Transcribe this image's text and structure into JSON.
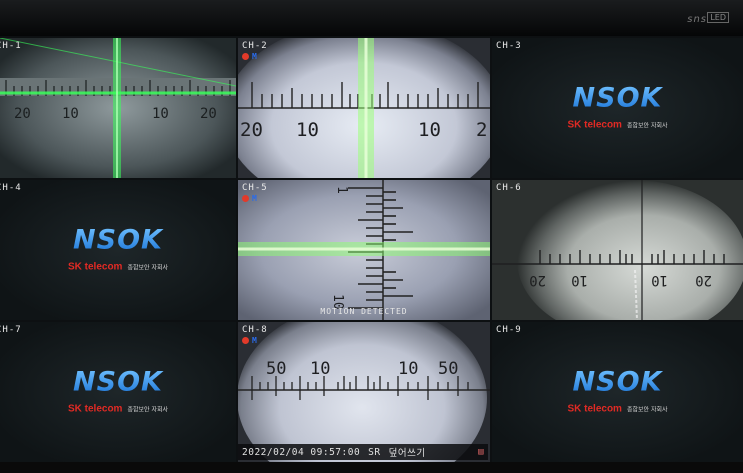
{
  "bezel": {
    "brand": "sns",
    "badge": "LED"
  },
  "channels": [
    {
      "id": "ch1",
      "label": "CH-1",
      "type": "camera",
      "indicators": false
    },
    {
      "id": "ch2",
      "label": "CH-2",
      "type": "camera",
      "indicators": true,
      "motion_flag": "M"
    },
    {
      "id": "ch3",
      "label": "CH-3",
      "type": "logo"
    },
    {
      "id": "ch4",
      "label": "CH-4",
      "type": "logo"
    },
    {
      "id": "ch5",
      "label": "CH-5",
      "type": "camera",
      "indicators": true,
      "motion_flag": "M",
      "overlay": "MOTION DETECTED"
    },
    {
      "id": "ch6",
      "label": "CH-6",
      "type": "camera",
      "indicators": false
    },
    {
      "id": "ch7",
      "label": "CH-7",
      "type": "logo"
    },
    {
      "id": "ch8",
      "label": "CH-8",
      "type": "camera",
      "indicators": true,
      "motion_flag": "M"
    },
    {
      "id": "ch9",
      "label": "CH-9",
      "type": "logo"
    }
  ],
  "logo": {
    "main": "NSOK",
    "sub": "SK telecom",
    "tagline": "종합보안 자회사"
  },
  "scales": {
    "ch1": [
      "20",
      "10",
      "10",
      "20"
    ],
    "ch2": [
      "20",
      "10",
      "10",
      "2"
    ],
    "ch6": [
      "20",
      "10",
      "10",
      "20"
    ],
    "ch8": [
      "50",
      "10",
      "10",
      "50"
    ],
    "ch5": [
      "1",
      "10"
    ]
  },
  "status": {
    "datetime": "2022/02/04 09:57:00",
    "mode": "SR",
    "overwrite": "덮어쓰기"
  },
  "colors": {
    "logo_blue": "#1e8ff0",
    "telecom_red": "#e22a24",
    "laser_green": "#39ff5a",
    "rec_red": "#e23a2a"
  }
}
